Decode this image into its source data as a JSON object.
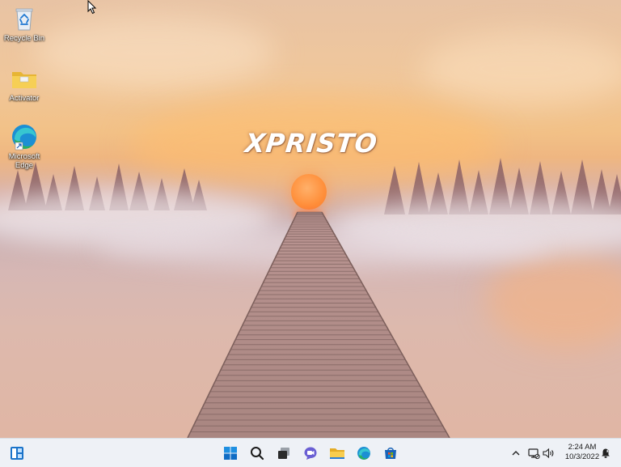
{
  "wallpaper": {
    "logo_text": "XPRISTO"
  },
  "desktop_icons": [
    {
      "label": "Recycle Bin",
      "icon": "recycle-bin-icon"
    },
    {
      "label": "Activator",
      "icon": "folder-icon"
    },
    {
      "label": "Microsoft Edge",
      "icon": "edge-icon"
    }
  ],
  "taskbar": {
    "left_widget": "widgets-icon",
    "pinned": [
      "start-icon",
      "search-icon",
      "task-view-icon",
      "chat-icon",
      "file-explorer-icon",
      "edge-icon",
      "store-icon"
    ],
    "tray": {
      "chevron": "chevron-up-icon",
      "network": "network-icon",
      "volume": "volume-icon",
      "notification": "notification-icon"
    },
    "clock": {
      "time": "2:24 AM",
      "date": "10/3/2022"
    }
  },
  "colors": {
    "taskbar_bg": "#eef1f6",
    "accent": "#0078d4",
    "sun": "#ff8f3a"
  }
}
